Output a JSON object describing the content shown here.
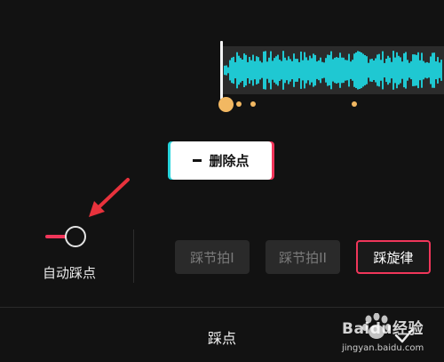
{
  "delete_button": {
    "label": "删除点"
  },
  "auto_beat": {
    "label": "自动踩点",
    "enabled": true
  },
  "options": [
    {
      "label": "踩节拍I",
      "selected": false
    },
    {
      "label": "踩节拍II",
      "selected": false
    },
    {
      "label": "踩旋律",
      "selected": true
    }
  ],
  "bottom_bar": {
    "title": "踩点"
  },
  "watermark": {
    "text": "Baidu经验",
    "url": "jingyan.baidu.com"
  },
  "colors": {
    "accent": "#f0365a",
    "waveform": "#1fc8d2",
    "beat": "#f2b862"
  },
  "icons": {
    "confirm": "check-icon",
    "annotation": "red-arrow"
  }
}
